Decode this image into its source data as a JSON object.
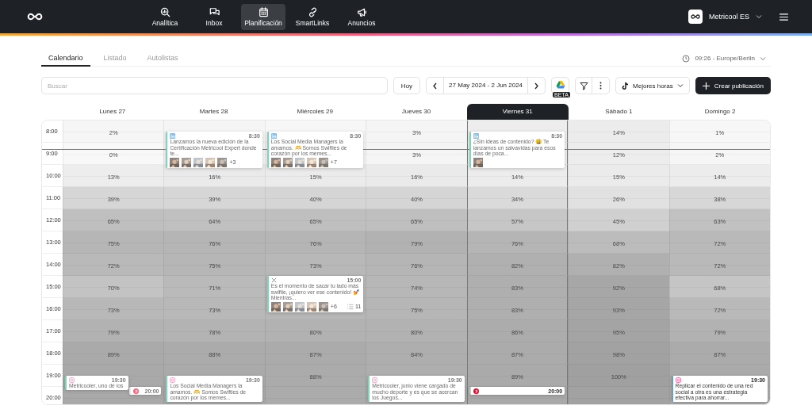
{
  "nav": {
    "items": [
      {
        "label": "Analítica",
        "kind": "analytics",
        "selected": false
      },
      {
        "label": "Inbox",
        "kind": "inbox",
        "selected": false
      },
      {
        "label": "Planificación",
        "kind": "calendar",
        "selected": true
      },
      {
        "label": "SmartLinks",
        "kind": "link",
        "selected": false
      },
      {
        "label": "Anuncios",
        "kind": "ads",
        "selected": false
      }
    ]
  },
  "account": {
    "name": "Metricool ES"
  },
  "view_tabs": [
    {
      "label": "Calendario",
      "selected": true
    },
    {
      "label": "Listado",
      "selected": false
    },
    {
      "label": "Autolistas",
      "selected": false
    }
  ],
  "timezone": "09:26 - Europe/Berlin",
  "toolbar": {
    "search": {
      "placeholder": "Buscar"
    },
    "today": "Hoy",
    "date_range": "27 May 2024 - 2 Jun 2024",
    "drive_badge": "BETA",
    "best_hours": "Mejores horas",
    "create": "Crear publicación"
  },
  "calendar": {
    "days": [
      {
        "label": "Lunes 27",
        "selected": false
      },
      {
        "label": "Martes 28",
        "selected": false
      },
      {
        "label": "Miércoles 29",
        "selected": false
      },
      {
        "label": "Jueves 30",
        "selected": false
      },
      {
        "label": "Viernes 31",
        "selected": true
      },
      {
        "label": "Sábado 1",
        "selected": false
      },
      {
        "label": "Domingo 2",
        "selected": false
      }
    ],
    "hours": [
      {
        "time": "8:00",
        "cells": [
          {
            "color": "#f6f6f6",
            "text": "2%"
          },
          {
            "color": "#f5f5f5",
            "posts": [
              {
                "kind": "linkedin",
                "time": "8:30",
                "past": true,
                "color": "#7fd6b6",
                "text": "Lanzamos la nueva edición de la Certificación Metricool Expert donde te...",
                "more": "+3"
              }
            ]
          },
          {
            "color": "#f7f7f7",
            "posts": [
              {
                "kind": "linkedin",
                "time": "8:30",
                "past": true,
                "color": "#7fd6b6",
                "text": "Los Social Media Managers la amamos. 🫶 Somos Swifties de corazón por los memes...",
                "more": "+7"
              }
            ]
          },
          {
            "color": "#f5f5f5",
            "text": "3%"
          },
          {
            "color": "#ededed",
            "posts": [
              {
                "kind": "linkedin",
                "time": "8:30",
                "past": true,
                "color": "#7fd6b6",
                "text": "¿Sin ideas de contenido? 😩 Te lanzamos un salvavidas para esos días de poca..."
              }
            ]
          },
          {
            "color": "#ececec",
            "text": "14%"
          },
          {
            "color": "#f7f7f7",
            "text": "1%"
          }
        ]
      },
      {
        "time": "9:00",
        "cells": [
          {
            "color": "#f8f8f8",
            "text": "0%"
          },
          {
            "color": "#f6f6f6"
          },
          {
            "color": "#f6f6f6"
          },
          {
            "color": "#f5f5f5",
            "text": "3%"
          },
          {
            "color": "#efefef"
          },
          {
            "color": "#ededed",
            "text": "12%"
          },
          {
            "color": "#f6f6f6",
            "text": "2%"
          }
        ]
      },
      {
        "time": "10:00",
        "cells": [
          {
            "color": "#ededed",
            "text": "13%"
          },
          {
            "color": "#eaeaea",
            "text": "16%"
          },
          {
            "color": "#ebebeb",
            "text": "15%"
          },
          {
            "color": "#eaeaea",
            "text": "16%"
          },
          {
            "color": "#ececec",
            "text": "14%"
          },
          {
            "color": "#ebebeb",
            "text": "15%"
          },
          {
            "color": "#ececec",
            "text": "14%"
          }
        ]
      },
      {
        "time": "11:00",
        "cells": [
          {
            "color": "#d6d6d6",
            "text": "39%"
          },
          {
            "color": "#d6d6d6",
            "text": "39%"
          },
          {
            "color": "#d5d5d5",
            "text": "40%"
          },
          {
            "color": "#d5d5d5",
            "text": "40%"
          },
          {
            "color": "#dadada",
            "text": "34%"
          },
          {
            "color": "#e1e1e1",
            "text": "26%"
          },
          {
            "color": "#d7d7d7",
            "text": "38%"
          }
        ]
      },
      {
        "time": "12:00",
        "cells": [
          {
            "color": "#bfbfbf",
            "text": "65%"
          },
          {
            "color": "#c0c0c0",
            "text": "64%"
          },
          {
            "color": "#bfbfbf",
            "text": "65%"
          },
          {
            "color": "#bfbfbf",
            "text": "65%"
          },
          {
            "color": "#c6c6c6",
            "text": "57%"
          },
          {
            "color": "#d0d0d0",
            "text": "45%"
          },
          {
            "color": "#c1c1c1",
            "text": "63%"
          }
        ]
      },
      {
        "time": "13:00",
        "cells": [
          {
            "color": "#b6b6b6",
            "text": "75%"
          },
          {
            "color": "#b5b5b5",
            "text": "76%"
          },
          {
            "color": "#b5b5b5",
            "text": "76%"
          },
          {
            "color": "#b2b2b2",
            "text": "79%"
          },
          {
            "color": "#b5b5b5",
            "text": "76%"
          },
          {
            "color": "#bcbcbc",
            "text": "68%"
          },
          {
            "color": "#b9b9b9",
            "text": "72%"
          }
        ]
      },
      {
        "time": "14:00",
        "cells": [
          {
            "color": "#b9b9b9",
            "text": "72%"
          },
          {
            "color": "#b6b6b6",
            "text": "75%"
          },
          {
            "color": "#b8b8b8",
            "text": "73%"
          },
          {
            "color": "#b5b5b5",
            "text": "76%"
          },
          {
            "color": "#b0b0b0",
            "text": "82%"
          },
          {
            "color": "#b0b0b0",
            "text": "82%"
          },
          {
            "color": "#b9b9b9",
            "text": "72%"
          }
        ]
      },
      {
        "time": "15:00",
        "cells": [
          {
            "color": "#c3c3c3",
            "text": "70%"
          },
          {
            "color": "#bababa",
            "text": "71%"
          },
          {
            "color": "#b8b8b8",
            "posts": [
              {
                "kind": "x",
                "time": "15:00",
                "past": true,
                "color": "#7fd6b6",
                "text": "Es el momento de sacar tu lado más swiftie, ¡quiero ver ese contenido! 💅 Mientras...",
                "more": "+6",
                "count": "11"
              }
            ]
          },
          {
            "color": "#b7b7b7",
            "text": "74%"
          },
          {
            "color": "#afafaf",
            "text": "83%"
          },
          {
            "color": "#a7a7a7",
            "text": "92%"
          },
          {
            "color": "#c5c5c5",
            "text": "68%"
          }
        ]
      },
      {
        "time": "16:00",
        "cells": [
          {
            "color": "#b8b8b8",
            "text": "73%"
          },
          {
            "color": "#b8b8b8",
            "text": "73%"
          },
          {
            "color": "#b7b7b7"
          },
          {
            "color": "#b6b6b6",
            "text": "75%"
          },
          {
            "color": "#afafaf",
            "text": "83%"
          },
          {
            "color": "#a6a6a6",
            "text": "93%"
          },
          {
            "color": "#b9b9b9",
            "text": "72%"
          }
        ]
      },
      {
        "time": "17:00",
        "cells": [
          {
            "color": "#b2b2b2",
            "text": "79%"
          },
          {
            "color": "#b3b3b3",
            "text": "78%"
          },
          {
            "color": "#b2b2b2",
            "text": "80%"
          },
          {
            "color": "#b2b2b2",
            "text": "80%"
          },
          {
            "color": "#acacac",
            "text": "86%"
          },
          {
            "color": "#a4a4a4",
            "text": "95%"
          },
          {
            "color": "#b2b2b2",
            "text": "79%"
          }
        ]
      },
      {
        "time": "18:00",
        "cells": [
          {
            "color": "#aaaaaa",
            "text": "89%"
          },
          {
            "color": "#ababab",
            "text": "88%"
          },
          {
            "color": "#ababab",
            "text": "87%"
          },
          {
            "color": "#aeaeae",
            "text": "84%"
          },
          {
            "color": "#ababab",
            "text": "87%"
          },
          {
            "color": "#a2a2a2",
            "text": "98%"
          },
          {
            "color": "#ababab",
            "text": "87%"
          }
        ]
      },
      {
        "time": "19:00",
        "cells": [
          {
            "color": "#a9a9a9",
            "posts": [
              {
                "kind": "instagram",
                "time": "19:30",
                "past": true,
                "color": "#7fd6b6",
                "text": "Metricooler, uno de los"
              }
            ]
          },
          {
            "color": "#aaaaaa",
            "posts": [
              {
                "kind": "instagram",
                "time": "19:30",
                "past": true,
                "color": "#7fd6b6",
                "text": "Los Social Media Managers la amamos. 🫶 Somos Swifties de corazón por los memes..."
              }
            ]
          },
          {
            "color": "#ababab",
            "text": "88%"
          },
          {
            "color": "#aeaeae",
            "posts": [
              {
                "kind": "instagram",
                "time": "19:30",
                "past": true,
                "color": "#7fd6b6",
                "text": "Metricooler, junio viene cargado de mucho deporte y es que se acercan los Juegos..."
              }
            ]
          },
          {
            "color": "#aaaaaa",
            "text": "89%"
          },
          {
            "color": "#a0a0a0",
            "text": "100%"
          },
          {
            "color": "#aaaaaa",
            "posts": [
              {
                "kind": "instagram",
                "time": "19:30",
                "past": false,
                "color": "#6f9cc4",
                "text": "Replicar el contenido de una red social a otra es una estrategia efectiva para ahorrar..."
              }
            ]
          }
        ]
      },
      {
        "time": "20:00",
        "cells": [
          {
            "color": "#a9a9a9",
            "posts": [
              {
                "kind": "pinterest",
                "time": "20:00",
                "past": true,
                "color": "#e8e8e8"
              }
            ]
          },
          {
            "color": "#a9a9a9"
          },
          {
            "color": "#ababab"
          },
          {
            "color": "#acacac"
          },
          {
            "color": "#a9a9a9",
            "posts": [
              {
                "kind": "pinterest",
                "time": "20:00",
                "past": false,
                "color": "#c9c9c9"
              }
            ]
          },
          {
            "color": "#a2a2a2"
          },
          {
            "color": "#ababab"
          }
        ]
      }
    ]
  }
}
